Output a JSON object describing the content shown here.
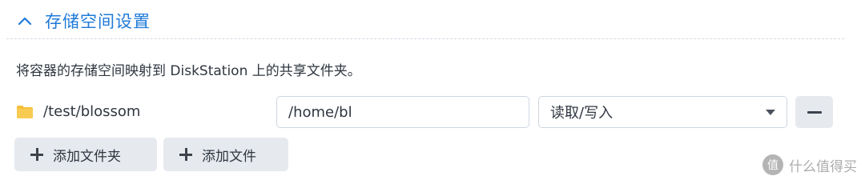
{
  "section": {
    "title": "存储空间设置",
    "chevron_icon": "chevron-up-icon",
    "accent_color": "#1f7ad8"
  },
  "description": "将容器的存储空间映射到 DiskStation 上的共享文件夹。",
  "volume": {
    "folder_icon": "folder-icon",
    "source_path": "/test/blossom",
    "mount_path": "/home/bl",
    "permission": "读取/写入",
    "remove_icon": "minus-icon"
  },
  "buttons": {
    "add_folder": "添加文件夹",
    "add_file": "添加文件"
  },
  "watermark": {
    "text": "什么值得买",
    "logo_icon": "zhi-logo-icon"
  }
}
